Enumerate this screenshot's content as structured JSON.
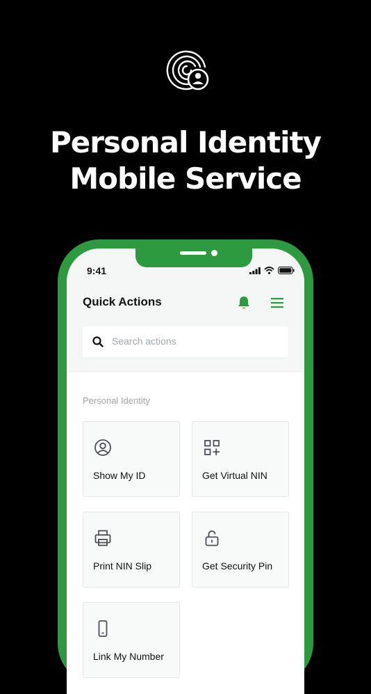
{
  "hero": {
    "line1": "Personal Identity",
    "line2": "Mobile Service"
  },
  "status_bar": {
    "time": "9:41"
  },
  "header": {
    "title": "Quick Actions"
  },
  "search": {
    "placeholder": "Search actions"
  },
  "section": {
    "label": "Personal Identity"
  },
  "actions": [
    {
      "label": "Show My ID",
      "icon": "user-circle-icon"
    },
    {
      "label": "Get Virtual NIN",
      "icon": "qr-grid-icon"
    },
    {
      "label": "Print NIN Slip",
      "icon": "printer-icon"
    },
    {
      "label": "Get Security Pin",
      "icon": "unlock-icon"
    },
    {
      "label": "Link My Number",
      "icon": "phone-icon"
    }
  ],
  "colors": {
    "accent": "#2e9a3f",
    "background": "#000000"
  }
}
